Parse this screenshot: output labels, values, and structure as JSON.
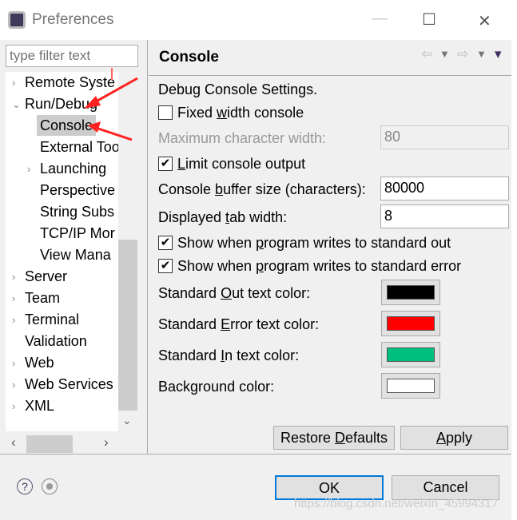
{
  "window": {
    "title": "Preferences",
    "minimize": "—",
    "maximize": "☐",
    "close": "✕"
  },
  "filter": {
    "placeholder": "type filter text"
  },
  "tree": [
    {
      "label": "Remote Syste",
      "chev": "›",
      "level": 0
    },
    {
      "label": "Run/Debug",
      "chev": "⌄",
      "level": 0
    },
    {
      "label": "Console",
      "chev": "",
      "level": 1,
      "selected": true
    },
    {
      "label": "External Too",
      "chev": "",
      "level": 1
    },
    {
      "label": "Launching",
      "chev": "›",
      "level": 1
    },
    {
      "label": "Perspective",
      "chev": "",
      "level": 1
    },
    {
      "label": "String Subs",
      "chev": "",
      "level": 1
    },
    {
      "label": "TCP/IP Mor",
      "chev": "",
      "level": 1
    },
    {
      "label": "View Mana",
      "chev": "",
      "level": 1
    },
    {
      "label": "Server",
      "chev": "›",
      "level": 0
    },
    {
      "label": "Team",
      "chev": "›",
      "level": 0
    },
    {
      "label": "Terminal",
      "chev": "›",
      "level": 0
    },
    {
      "label": "Validation",
      "chev": "",
      "level": 0
    },
    {
      "label": "Web",
      "chev": "›",
      "level": 0
    },
    {
      "label": "Web Services",
      "chev": "›",
      "level": 0
    },
    {
      "label": "XML",
      "chev": "›",
      "level": 0
    }
  ],
  "page": {
    "title": "Console",
    "nav": {
      "back": "⇦",
      "forward": "⇨",
      "menu": "▾"
    },
    "section": "Debug Console Settings.",
    "fixed_width": {
      "pre": "Fixed ",
      "key": "w",
      "post": "idth console",
      "checked": false
    },
    "max_width": {
      "label": "Maximum character width:",
      "value": "80"
    },
    "limit": {
      "pre": "",
      "key": "L",
      "post": "imit console output",
      "checked": true
    },
    "buffer": {
      "pre": "Console ",
      "key": "b",
      "post": "uffer size (characters):",
      "value": "80000"
    },
    "tab": {
      "pre": "Displayed ",
      "key": "t",
      "post": "ab width:",
      "value": "8"
    },
    "show_out": {
      "pre": "Show when ",
      "key": "p",
      "post": "rogram writes to standard out",
      "checked": true
    },
    "show_err": {
      "pre": "Show when ",
      "key": "p",
      "post": "rogram writes to standard error",
      "checked": true
    },
    "colors": [
      {
        "pre": "Standard ",
        "key": "O",
        "post": "ut text color:",
        "color": "#000000"
      },
      {
        "pre": "Standard ",
        "key": "E",
        "post": "rror text color:",
        "color": "#ff0000"
      },
      {
        "pre": "Standard ",
        "key": "I",
        "post": "n text color:",
        "color": "#00c080"
      },
      {
        "pre": "Back",
        "key": "g",
        "post": "round color:",
        "color": "#ffffff"
      }
    ],
    "restore": {
      "pre": "Restore ",
      "key": "D",
      "post": "efaults"
    },
    "apply": {
      "pre": "",
      "key": "A",
      "post": "pply"
    }
  },
  "footer": {
    "ok": "OK",
    "cancel": "Cancel",
    "help_icon": "?"
  },
  "watermark": "https://blog.csdn.net/weixin_45994317"
}
